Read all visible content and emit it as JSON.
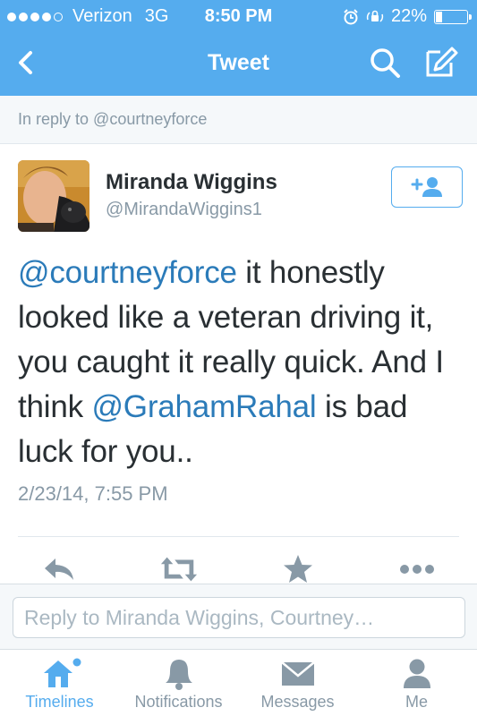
{
  "status_bar": {
    "carrier": "Verizon",
    "network": "3G",
    "time": "8:50 PM",
    "battery": "22%",
    "battery_level": 0.22,
    "signal_bars": 4
  },
  "nav": {
    "title": "Tweet",
    "back_icon": "chevron-left-icon",
    "search_icon": "search-icon",
    "compose_icon": "compose-icon"
  },
  "in_reply_to": "In reply to @courtneyforce",
  "tweet": {
    "author_name": "Miranda Wiggins",
    "author_handle": "@MirandaWiggins1",
    "follow_icon": "add-user-icon",
    "text_parts": [
      {
        "text": "@courtneyforce",
        "mention": true
      },
      {
        "text": " it honestly looked like a veteran driving it, you caught it really quick. And I think ",
        "mention": false
      },
      {
        "text": "@GrahamRahal",
        "mention": true
      },
      {
        "text": " is bad luck for you..",
        "mention": false
      }
    ],
    "timestamp": "2/23/14, 7:55 PM"
  },
  "actions": [
    {
      "name": "reply-icon"
    },
    {
      "name": "retweet-icon"
    },
    {
      "name": "favorite-icon"
    },
    {
      "name": "more-icon"
    }
  ],
  "reply_box": {
    "placeholder": "Reply to Miranda Wiggins, Courtney…"
  },
  "tabs": [
    {
      "label": "Timelines",
      "icon": "home-icon",
      "active": true
    },
    {
      "label": "Notifications",
      "icon": "bell-icon",
      "active": false
    },
    {
      "label": "Messages",
      "icon": "envelope-icon",
      "active": false
    },
    {
      "label": "Me",
      "icon": "person-icon",
      "active": false
    }
  ],
  "colors": {
    "brand_blue": "#55acee",
    "mention_blue": "#2b7bb9",
    "text": "#292f33",
    "muted": "#8899a6"
  }
}
